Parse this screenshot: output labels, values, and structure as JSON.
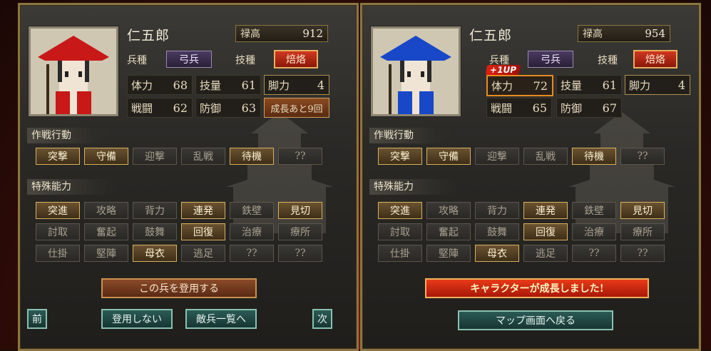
{
  "left": {
    "name": "仁五郎",
    "rokudaka_label": "禄高",
    "rokudaka_value": "912",
    "heishu_label": "兵種",
    "heishu_value": "弓兵",
    "giho_label": "技種",
    "giho_value": "焙烙",
    "stats": [
      {
        "label": "体力",
        "value": "68"
      },
      {
        "label": "技量",
        "value": "61"
      },
      {
        "label": "脚力",
        "value": "4"
      },
      {
        "label": "戦闘",
        "value": "62"
      },
      {
        "label": "防御",
        "value": "63"
      }
    ],
    "growth_text": "成長あと9回",
    "tactics_title": "作戦行動",
    "tactics": [
      "突撃",
      "守備",
      "迎撃",
      "乱戦",
      "待機",
      "??"
    ],
    "abilities_title": "特殊能力",
    "abilities": [
      "突進",
      "攻略",
      "背力",
      "連発",
      "鉄壁",
      "見切",
      "討取",
      "奮起",
      "鼓舞",
      "回復",
      "治療",
      "療所",
      "仕掛",
      "堅陣",
      "母衣",
      "逃足",
      "??",
      "??"
    ],
    "recruit_button": "この兵を登用する",
    "prev_button": "前",
    "decline_button": "登用しない",
    "enemy_list_button": "敵兵一覧へ",
    "next_button": "次"
  },
  "right": {
    "name": "仁五郎",
    "rokudaka_label": "禄高",
    "rokudaka_value": "954",
    "heishu_label": "兵種",
    "heishu_value": "弓兵",
    "giho_label": "技種",
    "giho_value": "焙烙",
    "up_badge": "+1UP",
    "stats": [
      {
        "label": "体力",
        "value": "72"
      },
      {
        "label": "技量",
        "value": "61"
      },
      {
        "label": "脚力",
        "value": "4"
      },
      {
        "label": "戦闘",
        "value": "65"
      },
      {
        "label": "防御",
        "value": "67"
      }
    ],
    "tactics_title": "作戦行動",
    "tactics": [
      "突撃",
      "守備",
      "迎撃",
      "乱戦",
      "待機",
      "??"
    ],
    "abilities_title": "特殊能力",
    "abilities": [
      "突進",
      "攻略",
      "背力",
      "連発",
      "鉄壁",
      "見切",
      "討取",
      "奮起",
      "鼓舞",
      "回復",
      "治療",
      "療所",
      "仕掛",
      "堅陣",
      "母衣",
      "逃足",
      "??",
      "??"
    ],
    "growth_banner": "キャラクターが成長しました!",
    "map_button": "マップ画面へ戻る"
  },
  "colors": {
    "hat_left": "#c81818",
    "hat_right": "#1848c8",
    "accent_gold": "#d8b060"
  }
}
